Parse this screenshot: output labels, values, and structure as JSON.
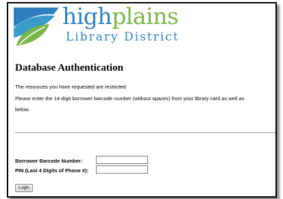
{
  "brand": {
    "name_part1": "high",
    "name_part2": "plains",
    "subtitle": "Library District",
    "colors": {
      "blue": "#2f7fc0",
      "green": "#7ab648",
      "teal": "#3a9cc8"
    }
  },
  "page": {
    "title": "Database Authentication",
    "message_line1": "The resources you have requested are restricted",
    "message_line2": "Please enter the 14-digit borrower barcode number (without spaces) from your library card as well as",
    "message_line3": "below."
  },
  "form": {
    "barcode_label": "Borrower Barcode Number:",
    "barcode_value": "",
    "pin_label": "PIN (Last 4 Digits of Phone #):",
    "pin_value": "",
    "login_label": "Login"
  }
}
